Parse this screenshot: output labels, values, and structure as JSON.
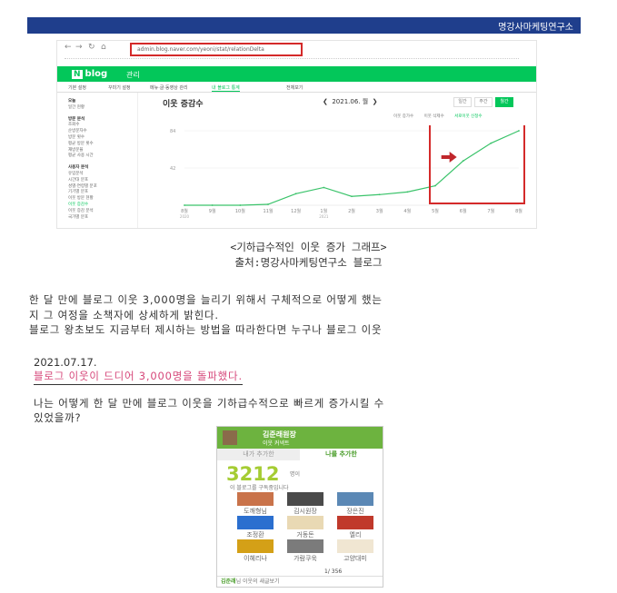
{
  "header": {
    "org": "명강사마케팅연구소"
  },
  "screenshot": {
    "url": "admin.blog.naver.com/yeoni/stat/relationDelta",
    "logo": "blog",
    "menu": "관리",
    "tabs": [
      "기본 설정",
      "꾸미기 설정",
      "메뉴·글·동영상 관리",
      "내 블로그 통계",
      "전체보기"
    ],
    "sidebar": [
      {
        "text": "오늘",
        "head": true
      },
      {
        "text": "일간 현황"
      },
      {
        "text": "방문 분석",
        "head": true
      },
      {
        "text": "조회수"
      },
      {
        "text": "순방문자수"
      },
      {
        "text": "방문 횟수"
      },
      {
        "text": "평균 방문 횟수"
      },
      {
        "text": "재방문율"
      },
      {
        "text": "평균 사용 시간"
      },
      {
        "text": "사용자 분석",
        "head": true
      },
      {
        "text": "유입분석"
      },
      {
        "text": "시간대 분포"
      },
      {
        "text": "성별·연령별 분포"
      },
      {
        "text": "기기별 분포"
      },
      {
        "text": "이웃 방문 현황"
      },
      {
        "text": "이웃 증감수"
      },
      {
        "text": "이웃 증감 분석"
      },
      {
        "text": "국가별 분포"
      }
    ],
    "chart_title": "이웃 증감수",
    "date_label": "2021.06. 월",
    "period_buttons": [
      "일간",
      "주간",
      "월간"
    ],
    "legend": [
      "이웃 증가수",
      "이웃 삭제수",
      "서로이웃 신청수"
    ]
  },
  "chart_data": {
    "type": "line",
    "categories": [
      "8월",
      "9월",
      "10월",
      "11월",
      "12월",
      "1월",
      "2월",
      "3월",
      "4월",
      "5월",
      "6월",
      "7월",
      "8월"
    ],
    "year_labels": [
      "2020",
      "2021"
    ],
    "yticks": [
      42,
      84
    ],
    "ylim": [
      0,
      84
    ],
    "values": [
      0,
      0,
      0,
      1,
      13,
      20,
      10,
      12,
      15,
      22,
      50,
      70,
      84
    ]
  },
  "captions": {
    "line1": "<기하급수적인 이웃 증가 그래프>",
    "line2": "출처:명강사마케팅연구소 블로그"
  },
  "body": {
    "p1": "한 달 만에 블로그 이웃 3,000명을 늘리기 위해서 구체적으로 어떻게 했는",
    "p2": "지 그 여정을 소책자에 상세하게 밝힌다.",
    "p3": "블로그 왕초보도 지금부터 제시하는 방법을 따라한다면 누구나 블로그 이웃",
    "date": "2021.07.17.",
    "highlight": "블로그 이웃이 드디어 3,000명을 돌파했다.",
    "q1": "나는 어떻게 한 달 만에 블로그 이웃을 기하급수적으로 빠르게 증가시킬 수",
    "q2": "있었을까?"
  },
  "widget": {
    "name": "김준래원장",
    "sub": "이웃 커넥트",
    "tab1": "내가 추가한",
    "tab2": "나를 추가한",
    "count": "3212",
    "unit": "명이",
    "desc": "이 블로그를 구독중입니다",
    "neighbors": [
      "도깨형님",
      "김시원장",
      "장은진",
      "조정환",
      "거동돈",
      "엘리",
      "이혜리나",
      "가람쿠욱",
      "고양대미"
    ],
    "page": "1/ 356",
    "footer_name": "김준래",
    "footer_text": "님 이웃의 새글보기"
  }
}
